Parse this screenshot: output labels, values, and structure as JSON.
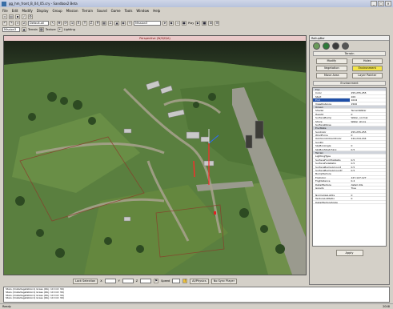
{
  "window": {
    "title": "gg_hm_front_B_04_05.cry - Sandbox2 Beta"
  },
  "menu": [
    "File",
    "Edit",
    "Modify",
    "Display",
    "Group",
    "Mission",
    "Terrain",
    "Sound",
    "Game",
    "Tools",
    "Window",
    "Help"
  ],
  "toolbar": {
    "layer_combo": "Default-all",
    "object_combo": "Mission3",
    "terrain_label": "Terrain",
    "texture_label": "Texture",
    "lighting_label": "Lighting",
    "play_label": "Play"
  },
  "viewport": {
    "header": "Perspective (W/S/D/A)"
  },
  "viewport_status": {
    "lock_selection": "Lock Selection",
    "x": "X",
    "y": "Y",
    "z": "Z",
    "speed_label": "Speed",
    "ai_physics": "AI/Physics",
    "no_sync_player": "No Sync Player"
  },
  "rollup": {
    "header": "RollupBar",
    "terrain_title": "Terrain",
    "buttons": [
      "Modify",
      "Holes",
      "Vegetation",
      "Environment",
      "Move Area",
      "Layer Painter"
    ],
    "environment_title": "Environment",
    "apply": "Apply"
  },
  "props": [
    {
      "g": true,
      "n": "Fog"
    },
    {
      "n": "Color",
      "v": "255,255,255"
    },
    {
      "n": "Start",
      "v": "100"
    },
    {
      "n": "End",
      "v": "1024",
      "sel": true
    },
    {
      "n": "ViewDistance",
      "v": "1500"
    },
    {
      "g": true,
      "n": "Ocean"
    },
    {
      "n": "Shader",
      "v": "TerrainWater"
    },
    {
      "n": "Height",
      "v": "0"
    },
    {
      "n": "SurfaceBump",
      "v": "Water_normal"
    },
    {
      "n": "Shore",
      "v": "Water_shore"
    },
    {
      "n": "SurfaceNoise",
      "v": ""
    },
    {
      "g": true,
      "n": "EnvState"
    },
    {
      "n": "SunColor",
      "v": "255,255,255"
    },
    {
      "n": "WindForce",
      "v": "0"
    },
    {
      "n": "OutdoorAmbientColor",
      "v": "244,244,244"
    },
    {
      "n": "SunDir",
      "v": ""
    },
    {
      "n": "SkyBoxAngle",
      "v": "0"
    },
    {
      "n": "SkyBoxStretching",
      "v": "0.5"
    },
    {
      "g": true,
      "n": "Terrain"
    },
    {
      "n": "LightingType",
      "v": ""
    },
    {
      "n": "SurfaceFromTopRatio",
      "v": "0.5"
    },
    {
      "n": "SurfaceFadeRatio",
      "v": "0.5"
    },
    {
      "n": "SurfaceBumpAmount",
      "v": "0.5"
    },
    {
      "n": "SurfaceBumpAmountY",
      "v": "0.5"
    },
    {
      "n": "BumpTexture",
      "v": ""
    },
    {
      "n": "FogColor",
      "v": "127,127,127"
    },
    {
      "n": "FogDistance",
      "v": "0.4"
    },
    {
      "n": "DetailTexture",
      "v": "detail.dds"
    },
    {
      "n": "Gravity",
      "v": "True"
    },
    {
      "n": "",
      "v": ""
    },
    {
      "n": "NormalizeLights",
      "v": "0"
    },
    {
      "n": "TextureLodRatio",
      "v": "0"
    },
    {
      "n": "DetailTextureScale",
      "v": ""
    }
  ],
  "log": [
    "Stars (CrateVegetation1) Grass (Obj: 10 Cnt: 39)",
    "Stars (CrateVegetation1) Grass (Obj: 10 Cnt: 39)",
    "Stars (CrateVegetation1) Grass (Obj: 10 Cnt: 39)",
    "Stars (CrateVegetation1) Grass (Obj: 10 Cnt: 39)"
  ],
  "statusbar": {
    "left": "Ready",
    "right": "2048"
  }
}
